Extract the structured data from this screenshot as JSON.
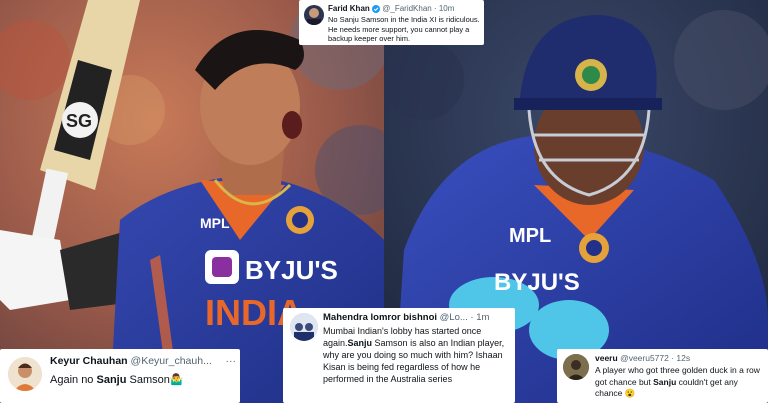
{
  "colors": {
    "jersey_blue": "#2a3f9c",
    "jersey_orange": "#e8682a",
    "tweet_bg": "#ffffff",
    "handle_grey": "#536471",
    "verified_blue": "#1d9bf0"
  },
  "photo_left": {
    "jersey_sponsor": "BYJU'S",
    "jersey_country": "INDIA",
    "jersey_maker": "MPL",
    "bat_logo": "SG"
  },
  "photo_right": {
    "jersey_sponsor": "BYJU'S",
    "jersey_maker": "MPL"
  },
  "tweets": {
    "farid": {
      "name": "Farid Khan",
      "handle": "@_FaridKhan · 10m",
      "text": "No Sanju Samson in the India XI is ridiculous. He needs more support, you cannot play a backup keeper over him.",
      "verified": true
    },
    "mahendra": {
      "name": "Mahendra lomror bishnoi",
      "handle": "@Lo... · 1m",
      "text_1": "Mumbai Indian's lobby has started once again.",
      "bold_1": "Sanju",
      "text_2": " Samson is also an Indian player, why are you doing so much with him? Ishaan Kisan is being fed regardless of how he performed in the Australia series"
    },
    "keyur": {
      "name": "Keyur Chauhan",
      "handle": "@Keyur_chauh...",
      "more": "···",
      "text_1": "Again no ",
      "bold_1": "Sanju",
      "text_2": " Samson🤷‍♂️"
    },
    "veeru": {
      "name": "veeru",
      "handle": "@veeru5772 · 12s",
      "text_1": "A player who got three golden duck in a row got chance but ",
      "bold_1": "Sanju",
      "text_2": " couldn't get any chance 😮"
    }
  }
}
